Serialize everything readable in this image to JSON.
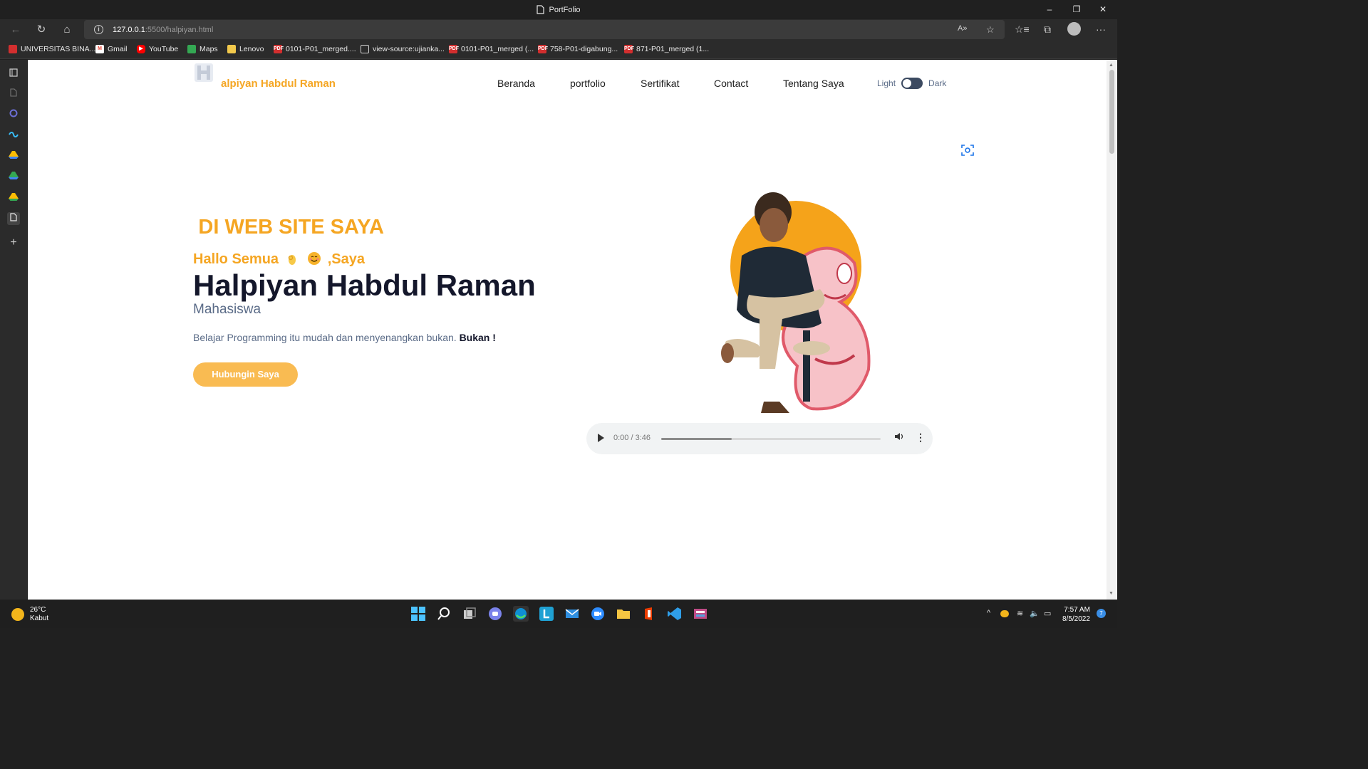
{
  "window": {
    "title": "PortFolio",
    "minimize": "–",
    "restore": "❐",
    "close": "✕"
  },
  "toolbar": {
    "url_host": "127.0.0.1",
    "url_path": ":5500/halpiyan.html",
    "info_symbol": "i",
    "read_aloud": "A»",
    "back": "←",
    "reload": "↻",
    "home": "⌂",
    "favorite_add": "☆",
    "favorites": "☆≡",
    "collections": "⧉",
    "menu": "···"
  },
  "bookmarks": [
    {
      "label": "UNIVERSITAS BINA...",
      "icon": "bsi-icon",
      "color": "#d32f2f"
    },
    {
      "label": "Gmail",
      "icon": "gmail-icon",
      "color": "#ea4335"
    },
    {
      "label": "YouTube",
      "icon": "youtube-icon",
      "color": "#ff0000"
    },
    {
      "label": "Maps",
      "icon": "maps-icon",
      "color": "#34a853"
    },
    {
      "label": "Lenovo",
      "icon": "folder-icon",
      "color": "#f2c94c"
    },
    {
      "label": "0101-P01_merged....",
      "icon": "pdf-icon",
      "color": "#d32f2f"
    },
    {
      "label": "view-source:ujianka...",
      "icon": "page-icon",
      "color": "#9e9e9e"
    },
    {
      "label": "0101-P01_merged (...",
      "icon": "pdf-icon",
      "color": "#d32f2f"
    },
    {
      "label": "758-P01-digabung...",
      "icon": "pdf-icon",
      "color": "#d32f2f"
    },
    {
      "label": "871-P01_merged (1...",
      "icon": "pdf-icon",
      "color": "#d32f2f"
    }
  ],
  "site": {
    "brand": "alpiyan Habdul Raman",
    "nav": [
      "Beranda",
      "portfolio",
      "Sertifikat",
      "Contact",
      "Tentang Saya"
    ],
    "theme_light": "Light",
    "theme_dark": "Dark",
    "marquee": "S DI WEB SITE SAYA",
    "greeting_start": "Hallo Semua",
    "greeting_end": ",Saya",
    "name": "Halpiyan Habdul Raman",
    "role": "Mahasiswa",
    "description": "Belajar Programming itu mudah dan menyenangkan bukan.",
    "description_bold": "Bukan !",
    "cta": "Hubungin Saya",
    "accent": "#f5a623",
    "dark_text": "#14172b"
  },
  "audio": {
    "time": "0:00 / 3:46",
    "progress_fraction": 0.32
  },
  "taskbar": {
    "temperature": "26°C",
    "weather": "Kabut",
    "time": "7:57 AM",
    "date": "8/5/2022",
    "notification_count": "7",
    "tray_chevron": "^",
    "wifi": "≋",
    "volume": "🔈",
    "battery": "▭"
  }
}
